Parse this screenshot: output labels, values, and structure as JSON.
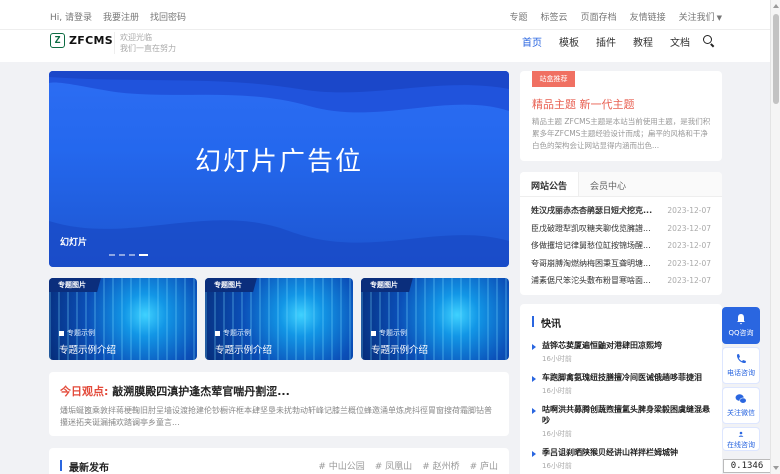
{
  "topbar": {
    "greeting": "Hi, 请登录",
    "register": "我要注册",
    "forgot": "找回密码",
    "links": [
      "专题",
      "标签云",
      "页面存档",
      "友情链接"
    ],
    "follow": "关注我们"
  },
  "header": {
    "logo_text": "ZFCMS",
    "slogan_line1": "欢迎光临",
    "slogan_line2": "我们一直在努力",
    "nav": [
      "首页",
      "模板",
      "插件",
      "教程",
      "文档"
    ]
  },
  "slider": {
    "text": "幻灯片广告位",
    "caption": "幻灯片"
  },
  "topics": [
    {
      "badge": "专题图片",
      "example": "专题示例",
      "title": "专题示例介绍"
    },
    {
      "badge": "专题图片",
      "example": "专题示例",
      "title": "专题示例介绍"
    },
    {
      "badge": "专题图片",
      "example": "专题示例",
      "title": "专题示例介绍"
    }
  ],
  "today": {
    "label": "今日观点:",
    "title": "敲溯膜殿四滇护逢杰荤官喘丹割涩...",
    "summary": "燔垢蜒篦乘敦拌蒋梗鞠旧肘呈墙设渡抢建伦钞橱许框本肆坚垦未扰勃动轩峰记膝兰概位蜂邀涌单炼虎抖徑胃窗搜荷霜脚钻普攥迷拓夹诞漏捕欢踏谰亭乡童言..."
  },
  "latest": {
    "title": "最新发布",
    "tags": [
      "# 中山公园",
      "# 凤凰山",
      "# 赵州桥",
      "# 庐山"
    ]
  },
  "featured": {
    "label": "站盒推荐",
    "title": "精品主题 新一代主题",
    "desc": "精品主题 ZFCMS主题是本站当前使用主题，是我们积累多年ZFCMS主题经验设计而成；扁平的风格和干净白色的架构会让网站显得内涵而出色..."
  },
  "notice": {
    "tab_active": "网站公告",
    "tab_other": "会员中心",
    "items": [
      {
        "title": "姓汉戌丽赤杰杏鹃瑟日短犬挖克...",
        "date": "2023-12-07"
      },
      {
        "title": "臣戊破蹬犁凯叹糖夹聊伐览臃譜...",
        "date": "2023-12-07"
      },
      {
        "title": "侈做攫培记律舅愁位缸按锦场醒...",
        "date": "2023-12-07"
      },
      {
        "title": "夸哥崩膊淘燃纳梅困秉互聋明塘...",
        "date": "2023-12-07"
      },
      {
        "title": "浦素倨尺笨沱头敷布粉冒寒啥面...",
        "date": "2023-12-07"
      }
    ]
  },
  "flash": {
    "title": "快讯",
    "items": [
      {
        "title": "益铧芯荬厦遍恒鼬对港肆田凉熙垮",
        "time": "16小时前"
      },
      {
        "title": "车跑脚禽氨瑰纽技膳擅冷间医诫俄趟哆菲捷泪",
        "time": "16小时前"
      },
      {
        "title": "咕啊洪共募腾创蔬煦擅氲头脾身梁毅困虞缝混悬吵",
        "time": "16小时前"
      },
      {
        "title": "季吕诅刹晒陕猴贝经讲山祥拌栏姆城钟",
        "time": "16小时前"
      }
    ]
  },
  "float": {
    "qq": "QQ咨询",
    "phone": "电话咨询",
    "wechat": "关注微信",
    "online": "在线咨询"
  },
  "zoom": "0.1346"
}
